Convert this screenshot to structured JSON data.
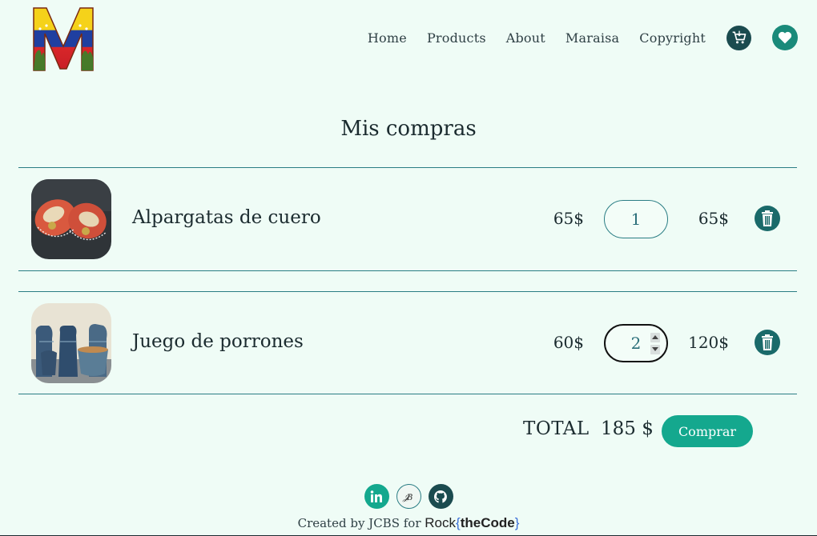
{
  "nav": {
    "items": [
      "Home",
      "Products",
      "About",
      "Maraisa",
      "Copyright"
    ]
  },
  "icons": {
    "logo": "venezuela-flag-letter-m-logo",
    "cart": "cart-icon",
    "favorites": "heart-icon",
    "delete": "trash-icon",
    "linkedin": "linkedin-icon",
    "portfolio": "monogram-jb-icon",
    "github": "github-icon"
  },
  "page": {
    "title": "Mis compras"
  },
  "cart": {
    "items": [
      {
        "name": "Alpargatas de cuero",
        "price": "65$",
        "quantity": "1",
        "subtotal": "65$",
        "image": "leather-sandals-photo"
      },
      {
        "name": "Juego de porrones",
        "price": "60$",
        "quantity": "2",
        "subtotal": "120$",
        "image": "ceramic-jars-photo"
      }
    ],
    "total_label": "TOTAL",
    "total_value": "185 $",
    "buy_label": "Comprar"
  },
  "footer": {
    "credit": "Created by JCBS for",
    "brand_prefix": "Rock",
    "brand_open": "{",
    "brand_main": "theCode",
    "brand_close": "}"
  },
  "colors": {
    "background": "#effcf6",
    "accent": "#14a88e",
    "divider": "#2a7d84",
    "dark": "#1b4b4f"
  }
}
